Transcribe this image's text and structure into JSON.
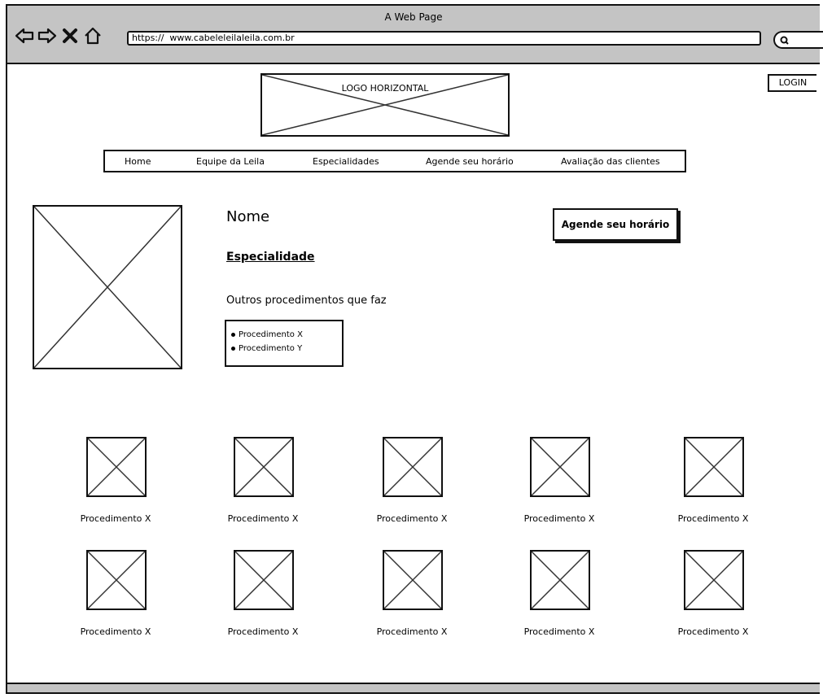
{
  "window": {
    "title": "A Web Page",
    "url": "https://  www.cabeleleilaleila.com.br"
  },
  "header": {
    "logo_label": "LOGO HORIZONTAL",
    "login_label": "LOGIN"
  },
  "nav": {
    "items": [
      {
        "label": "Home"
      },
      {
        "label": "Equipe da Leila"
      },
      {
        "label": "Especialidades"
      },
      {
        "label": "Agende seu horário"
      },
      {
        "label": "Avaliação das clientes"
      }
    ]
  },
  "profile": {
    "name": "Nome",
    "specialty": "Especialidade",
    "other_procedures_label": "Outros procedimentos que faz",
    "procedures": [
      "Procedimento X",
      "Procedimento Y"
    ],
    "book_button": "Agende seu horário"
  },
  "gallery": {
    "items": [
      {
        "caption": "Procedimento X"
      },
      {
        "caption": "Procedimento X"
      },
      {
        "caption": "Procedimento X"
      },
      {
        "caption": "Procedimento X"
      },
      {
        "caption": "Procedimento X"
      },
      {
        "caption": "Procedimento X"
      },
      {
        "caption": "Procedimento X"
      },
      {
        "caption": "Procedimento X"
      },
      {
        "caption": "Procedimento X"
      },
      {
        "caption": "Procedimento X"
      }
    ]
  },
  "icons": {
    "back": "back-arrow-icon",
    "forward": "forward-arrow-icon",
    "close": "close-icon",
    "home": "home-icon",
    "search": "search-icon"
  }
}
